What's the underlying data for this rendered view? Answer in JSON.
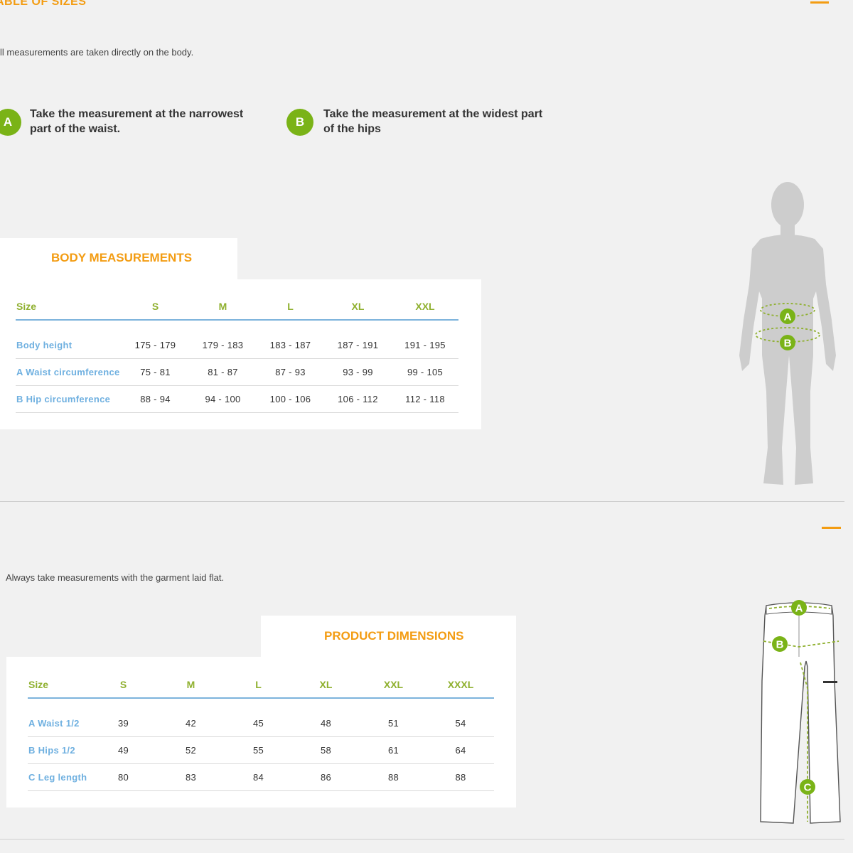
{
  "body_section": {
    "title": "ABLE OF SIZES",
    "note": "ll measurements are taken directly on the body.",
    "instructions": [
      {
        "badge": "A",
        "text_line1": "Take the measurement at the narrowest",
        "text_line2": "part of the waist."
      },
      {
        "badge": "B",
        "text_line1": "Take the measurement at the widest part",
        "text_line2": "of the hips"
      }
    ],
    "card_title": "BODY MEASUREMENTS",
    "table": {
      "headers": [
        "Size",
        "S",
        "M",
        "L",
        "XL",
        "XXL"
      ],
      "rows": [
        {
          "label": "Body height",
          "values": [
            "175 - 179",
            "179 - 183",
            "183 - 187",
            "187 - 191",
            "191 - 195"
          ]
        },
        {
          "label": "A Waist circumference",
          "values": [
            "75 - 81",
            "81 - 87",
            "87 - 93",
            "93 - 99",
            "99 - 105"
          ]
        },
        {
          "label": "B Hip circumference",
          "values": [
            "88 - 94",
            "94 - 100",
            "100 - 106",
            "106 - 112",
            "112 - 118"
          ]
        }
      ]
    },
    "figure_labels": {
      "a": "A",
      "b": "B"
    }
  },
  "product_section": {
    "note": "Always take measurements with the garment laid flat.",
    "card_title": "PRODUCT DIMENSIONS",
    "table": {
      "headers": [
        "Size",
        "S",
        "M",
        "L",
        "XL",
        "XXL",
        "XXXL"
      ],
      "rows": [
        {
          "label": "A Waist 1/2",
          "values": [
            "39",
            "42",
            "45",
            "48",
            "51",
            "54"
          ]
        },
        {
          "label": "B Hips 1/2",
          "values": [
            "49",
            "52",
            "55",
            "58",
            "61",
            "64"
          ]
        },
        {
          "label": "C Leg length",
          "values": [
            "80",
            "83",
            "84",
            "86",
            "88",
            "88"
          ]
        }
      ]
    },
    "figure_labels": {
      "a": "A",
      "b": "B",
      "c": "C"
    }
  },
  "colors": {
    "accent": "#f39c12",
    "green": "#7ab317",
    "blue_label": "#6fb0e0",
    "header_green": "#8fb02f"
  }
}
